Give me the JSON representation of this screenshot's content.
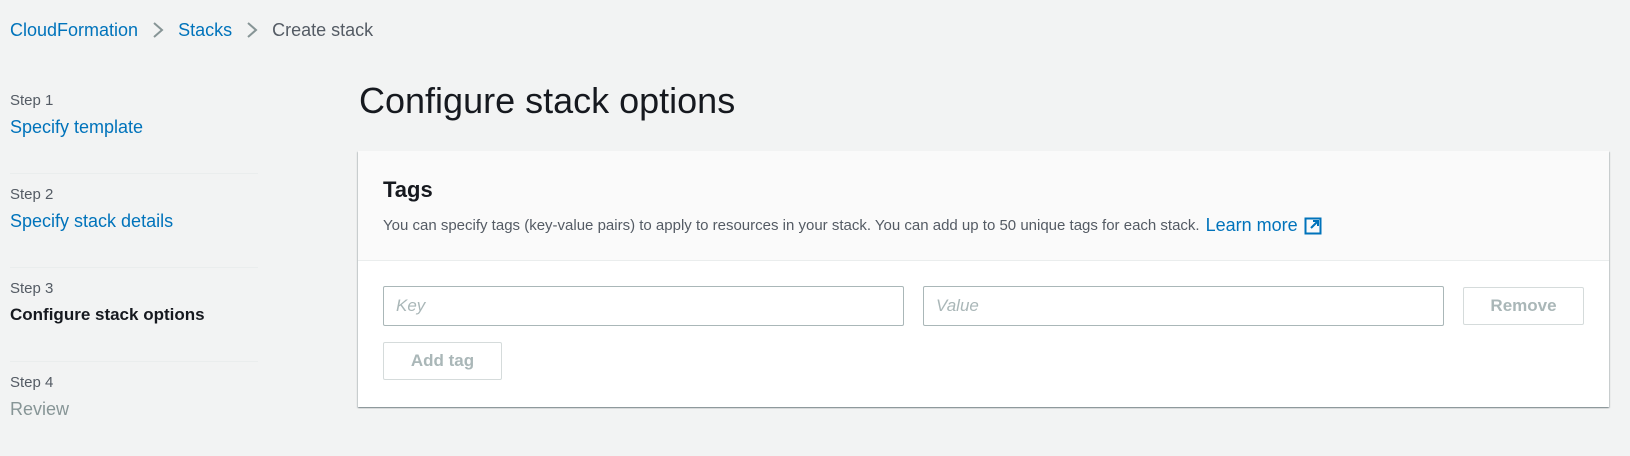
{
  "breadcrumb": {
    "items": [
      "CloudFormation",
      "Stacks",
      "Create stack"
    ]
  },
  "steps": [
    {
      "num": "Step 1",
      "title": "Specify template"
    },
    {
      "num": "Step 2",
      "title": "Specify stack details"
    },
    {
      "num": "Step 3",
      "title": "Configure stack options"
    },
    {
      "num": "Step 4",
      "title": "Review"
    }
  ],
  "page_title": "Configure stack options",
  "tags_panel": {
    "title": "Tags",
    "description": "You can specify tags (key-value pairs) to apply to resources in your stack. You can add up to 50 unique tags for each stack.",
    "learn_more": "Learn more",
    "key_placeholder": "Key",
    "value_placeholder": "Value",
    "remove_label": "Remove",
    "add_tag_label": "Add tag"
  },
  "colors": {
    "link": "#0073bb",
    "background": "#f2f3f3",
    "panel": "#ffffff"
  }
}
